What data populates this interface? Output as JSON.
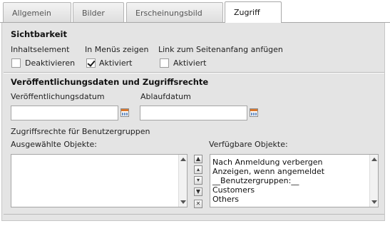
{
  "tabs": [
    {
      "label": "Allgemein",
      "active": false
    },
    {
      "label": "Bilder",
      "active": false
    },
    {
      "label": "Erscheinungsbild",
      "active": false
    },
    {
      "label": "Zugriff",
      "active": true
    }
  ],
  "visibility": {
    "title": "Sichtbarkeit",
    "content_element": {
      "label": "Inhaltselement",
      "checkbox_label": "Deaktivieren",
      "checked": false
    },
    "in_menus": {
      "label": "In Menüs zeigen",
      "checkbox_label": "Aktiviert",
      "checked": true
    },
    "top_link": {
      "label": "Link zum Seitenanfang anfügen",
      "checkbox_label": "Aktiviert",
      "checked": false
    }
  },
  "publish": {
    "title": "Veröffentlichungsdaten und Zugriffsrechte",
    "start_label": "Veröffentlichungsdatum",
    "start_value": "",
    "end_label": "Ablaufdatum",
    "end_value": "",
    "groups_label": "Zugriffsrechte für Benutzergruppen",
    "selected_label": "Ausgewählte Objekte:",
    "selected_items": [],
    "available_label": "Verfügbare Objekte:",
    "available_items": [
      "Nach Anmeldung verbergen",
      "Anzeigen, wenn angemeldet",
      "__Benutzergruppen:__",
      "Customers",
      "Others"
    ],
    "move_buttons": [
      "move-top",
      "move-up",
      "move-down",
      "move-bottom",
      "remove"
    ]
  },
  "colors": {
    "panel_bg": "#e4e4e4",
    "calendar_accent": "#d9772d"
  },
  "icons": [
    "calendar-icon",
    "checkmark-icon",
    "arrow-up-icon",
    "arrow-down-icon",
    "remove-icon"
  ]
}
